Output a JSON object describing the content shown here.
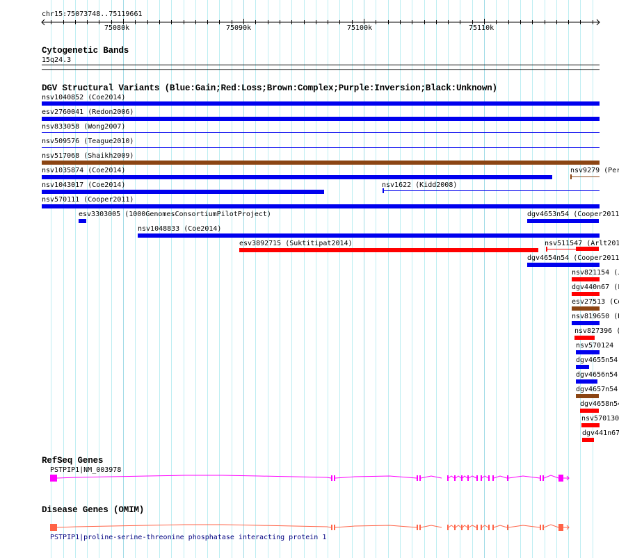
{
  "ruler": {
    "location": "chr15:75073748..75119661",
    "ticks": [
      "75080k",
      "75090k",
      "75100k",
      "75110k"
    ]
  },
  "cytoband": {
    "title": "Cytogenetic Bands",
    "band": "15q24.3"
  },
  "dgv": {
    "title": "DGV Structural Variants (Blue:Gain;Red:Loss;Brown:Complex;Purple:Inversion;Black:Unknown)",
    "colors": {
      "gain": "#0000ee",
      "loss": "#ff0000",
      "complex": "#8b4513"
    },
    "features": [
      {
        "label": "nsv1040852 (Coe2014)",
        "type": "gain"
      },
      {
        "label": "esv2760041 (Redon2006)",
        "type": "gain"
      },
      {
        "label": "nsv833058 (Wong2007)",
        "type": "gain"
      },
      {
        "label": "nsv509576 (Teague2010)",
        "type": "gain"
      },
      {
        "label": "nsv517068 (Shaikh2009)",
        "type": "complex"
      },
      {
        "label": "nsv1035874 (Coe2014)",
        "type": "gain"
      },
      {
        "label": "nsv9279 (Per",
        "type": "complex"
      },
      {
        "label": "nsv1043017 (Coe2014)",
        "type": "gain"
      },
      {
        "label": "nsv1622 (Kidd2008)",
        "type": "gain"
      },
      {
        "label": "nsv570111 (Cooper2011)",
        "type": "gain"
      },
      {
        "label": "esv3303005 (1000GenomesConsortiumPilotProject)",
        "type": "gain"
      },
      {
        "label": "dgv4653n54 (Cooper2011",
        "type": "gain"
      },
      {
        "label": "nsv1048833 (Coe2014)",
        "type": "gain"
      },
      {
        "label": "esv3892715 (Suktitipat2014)",
        "type": "loss"
      },
      {
        "label": "nsv511547 (Arlt201",
        "type": "loss"
      },
      {
        "label": "dgv4654n54 (Cooper2011",
        "type": "gain"
      },
      {
        "label": "nsv821154 (J",
        "type": "loss"
      },
      {
        "label": "dgv440n67 (F",
        "type": "loss"
      },
      {
        "label": "esv27513 (Co",
        "type": "complex"
      },
      {
        "label": "nsv819650 (H",
        "type": "gain"
      },
      {
        "label": "nsv827396 (",
        "type": "loss"
      },
      {
        "label": "nsv570124 (",
        "type": "gain"
      },
      {
        "label": "dgv4655n54",
        "type": "gain"
      },
      {
        "label": "dgv4656n54",
        "type": "gain"
      },
      {
        "label": "dgv4657n54",
        "type": "complex"
      },
      {
        "label": "dgv4658n54",
        "type": "loss"
      },
      {
        "label": "nsv570130",
        "type": "loss"
      },
      {
        "label": "dgv441n67",
        "type": "loss"
      }
    ]
  },
  "refseq": {
    "title": "RefSeq Genes",
    "gene": "PSTPIP1|NM_003978",
    "color": "#ff00ff"
  },
  "omim": {
    "title": "Disease Genes (OMIM)",
    "gene": "PSTPIP1|proline-serine-threonine phosphatase interacting protein 1",
    "color": "#ff6347",
    "label_color": "#000080"
  }
}
